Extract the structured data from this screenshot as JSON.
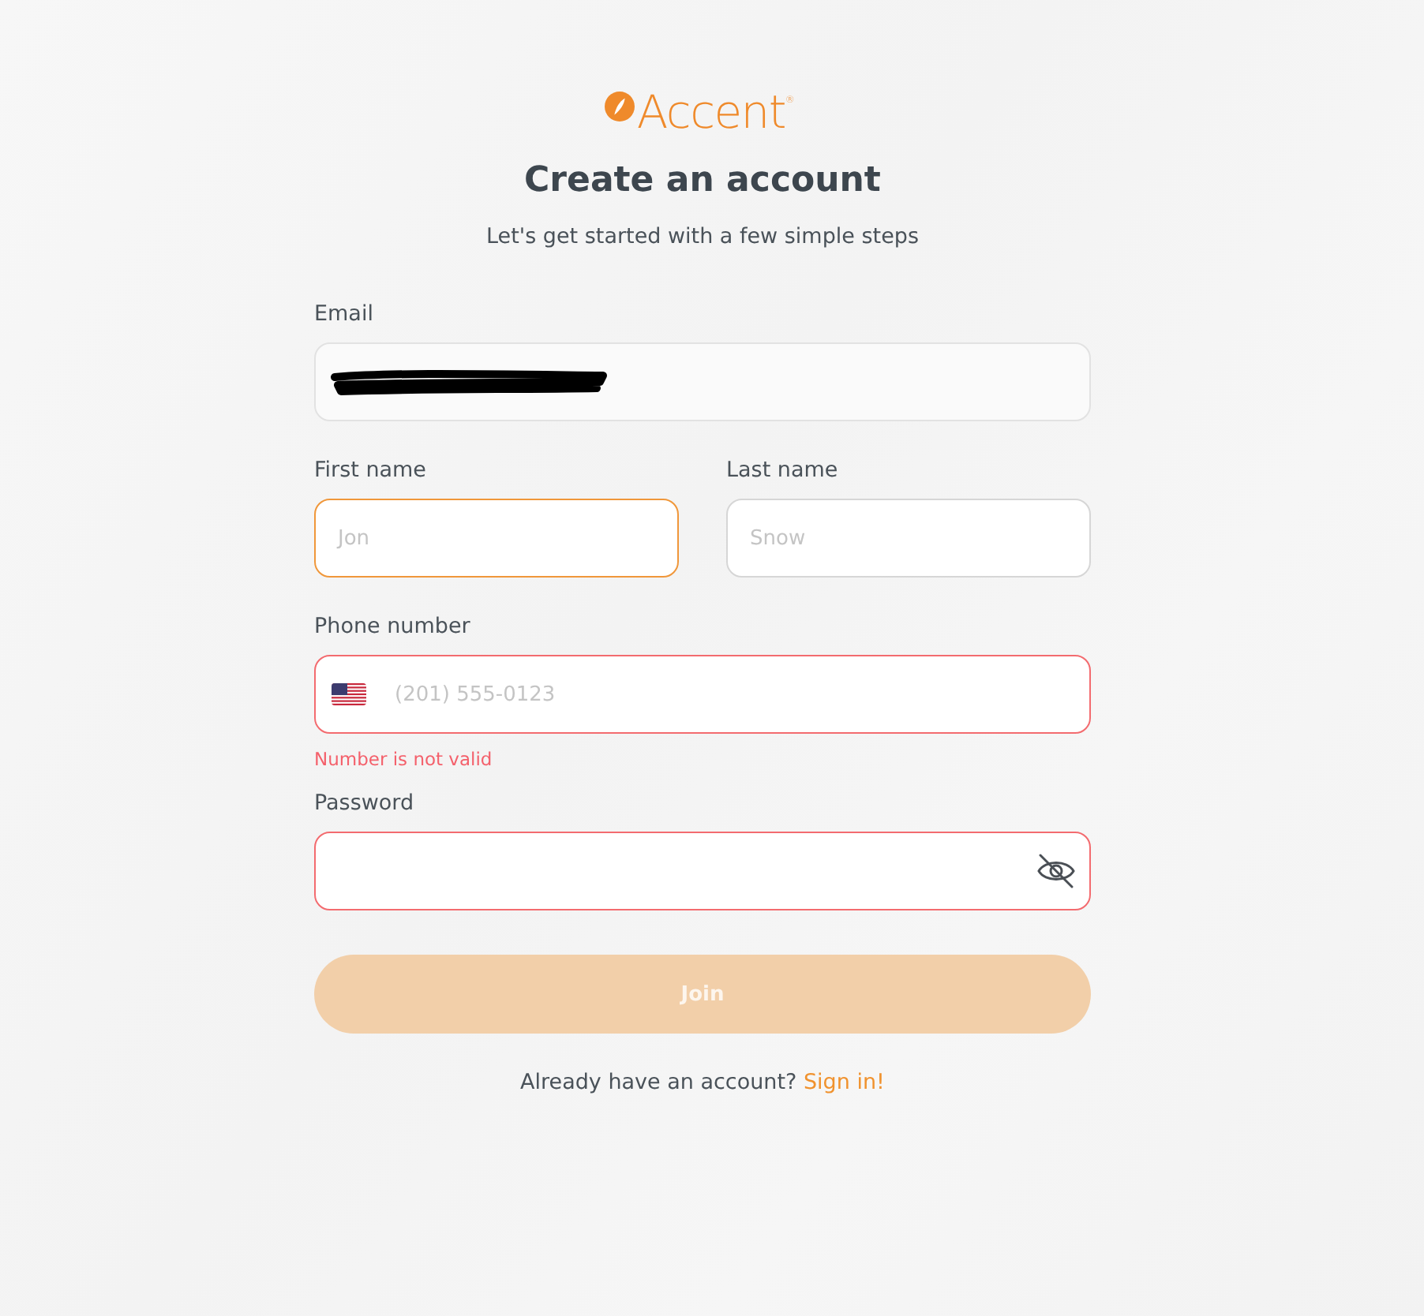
{
  "logo": {
    "text": "Accent$^{®}$"
  },
  "title": "Create an account",
  "subtitle": "Let's get started with a few simple steps",
  "email": {
    "label": "Email",
    "redacted": true,
    "readonly": true,
    "focused": false,
    "error": false
  },
  "name_fields": [
    {
      "label": "First name",
      "placeholder": "Jon",
      "focused": true,
      "error": false
    },
    {
      "label": "Last name",
      "placeholder": "Snow",
      "focused": false,
      "error": false
    }
  ],
  "phone": {
    "label": "Phone number",
    "placeholder": "(201) 555-0123",
    "error": true,
    "error_message": "Number is not valid"
  },
  "password": {
    "label": "Password",
    "error": true,
    "revealed": false
  },
  "join_button": {
    "label": "Join",
    "disabled": true
  },
  "signin_prompt": {
    "text": "Already have an account?",
    "link": "Sign in!"
  }
}
